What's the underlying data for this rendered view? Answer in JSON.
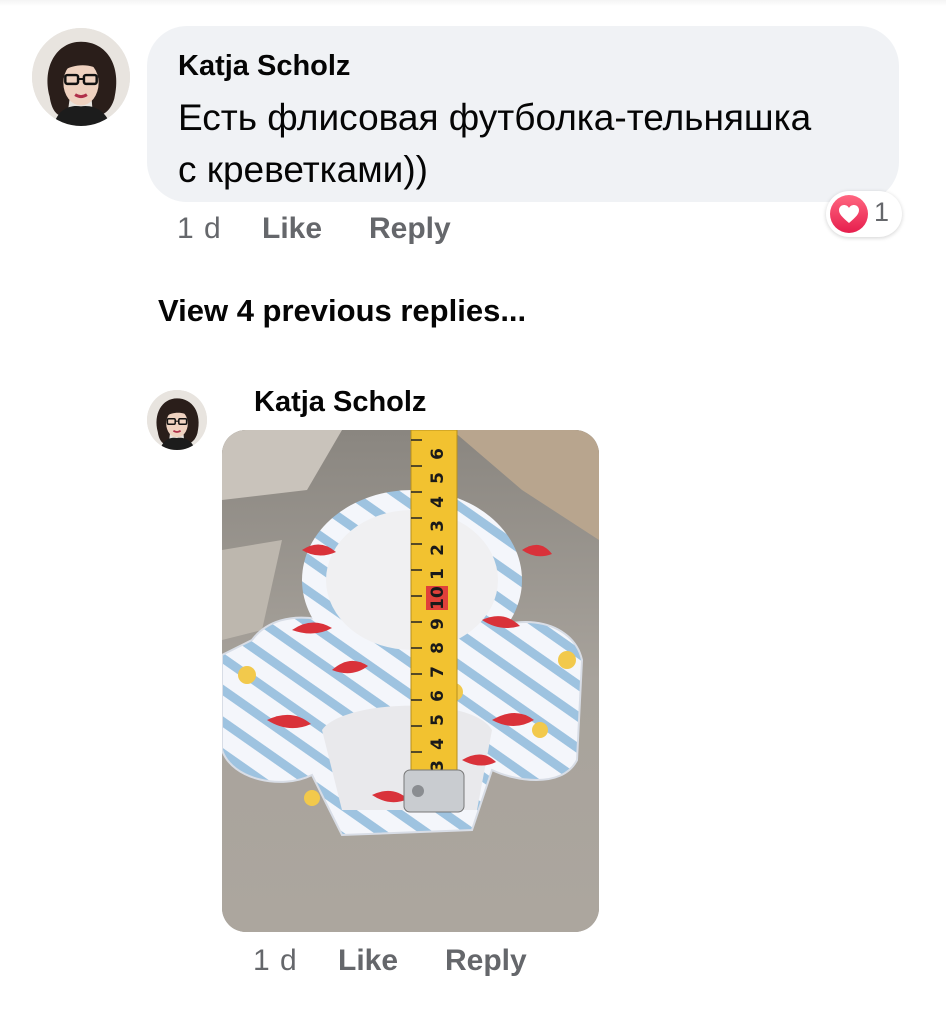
{
  "comment": {
    "author": "Katja Scholz",
    "text_line1": "Есть флисовая футболка-тельняшка",
    "text_line2": "с креветками))",
    "time": "1 d",
    "like_label": "Like",
    "reply_label": "Reply",
    "reaction_count": "1",
    "reaction_type": "love"
  },
  "view_previous": "View 4 previous replies...",
  "reply": {
    "author": "Katja Scholz",
    "image_description": "photo of shrimp print striped fleece shirt with measuring tape",
    "tape_numbers": [
      "3",
      "4",
      "5",
      "6",
      "7",
      "8",
      "9",
      "10",
      "1",
      "2",
      "3",
      "4",
      "5",
      "6"
    ],
    "time": "1 d",
    "like_label": "Like",
    "reply_label": "Reply"
  },
  "colors": {
    "bubble": "#f0f2f5",
    "meta_text": "#65676b",
    "love": "#f33e58",
    "tape": "#f2c230"
  }
}
